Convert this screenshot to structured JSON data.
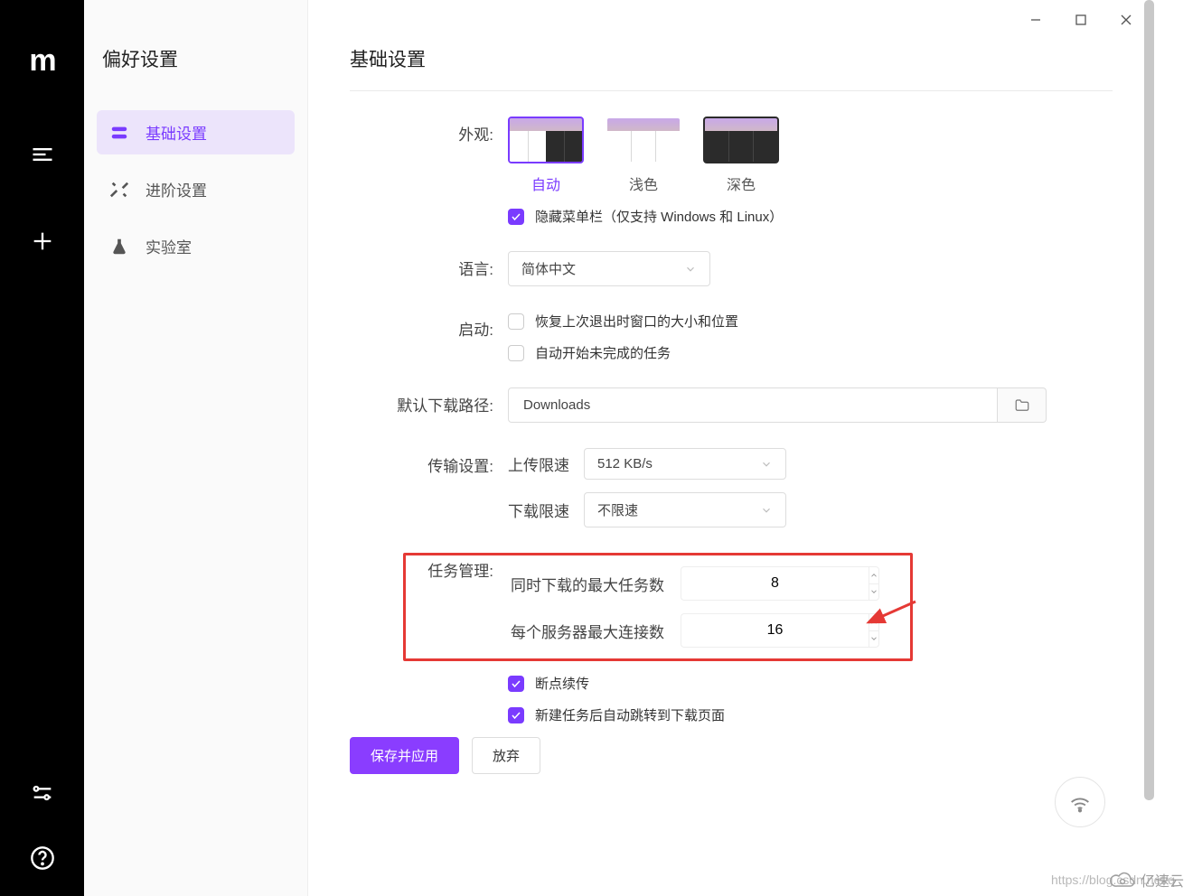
{
  "sidebar": {
    "title": "偏好设置",
    "items": [
      {
        "label": "基础设置"
      },
      {
        "label": "进阶设置"
      },
      {
        "label": "实验室"
      }
    ]
  },
  "main": {
    "title": "基础设置",
    "appearance": {
      "label": "外观:",
      "options": [
        "自动",
        "浅色",
        "深色"
      ],
      "hide_menu": "隐藏菜单栏（仅支持 Windows 和 Linux）"
    },
    "language": {
      "label": "语言:",
      "value": "简体中文"
    },
    "startup": {
      "label": "启动:",
      "restore_window": "恢复上次退出时窗口的大小和位置",
      "auto_start_tasks": "自动开始未完成的任务"
    },
    "download_path": {
      "label": "默认下载路径:",
      "value": "Downloads"
    },
    "transfer": {
      "label": "传输设置:",
      "upload_label": "上传限速",
      "upload_value": "512 KB/s",
      "download_label": "下载限速",
      "download_value": "不限速"
    },
    "task_mgmt": {
      "label": "任务管理:",
      "max_tasks_label": "同时下载的最大任务数",
      "max_tasks_value": "8",
      "max_conn_label": "每个服务器最大连接数",
      "max_conn_value": "16",
      "resume": "断点续传",
      "auto_jump": "新建任务后自动跳转到下载页面"
    },
    "actions": {
      "save": "保存并应用",
      "discard": "放弃"
    }
  },
  "watermark_url": "https://blog.csdn.net/q",
  "watermark_brand": "亿速云"
}
